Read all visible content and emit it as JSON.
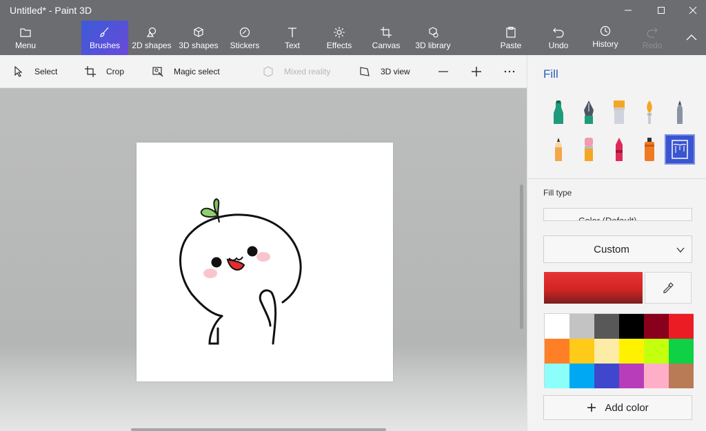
{
  "window": {
    "title": "Untitled* - Paint 3D"
  },
  "ribbon": {
    "items": [
      {
        "label": "Menu",
        "icon": "folder-icon"
      },
      {
        "label": "Brushes",
        "icon": "brush-icon",
        "active": true
      },
      {
        "label": "2D shapes",
        "icon": "2d-shapes-icon"
      },
      {
        "label": "3D shapes",
        "icon": "3d-cube-icon"
      },
      {
        "label": "Stickers",
        "icon": "sticker-icon"
      },
      {
        "label": "Text",
        "icon": "text-icon"
      },
      {
        "label": "Effects",
        "icon": "effects-sun-icon"
      },
      {
        "label": "Canvas",
        "icon": "canvas-crop-icon"
      },
      {
        "label": "3D library",
        "icon": "3d-library-icon"
      },
      {
        "label": "Paste",
        "icon": "paste-icon"
      },
      {
        "label": "Undo",
        "icon": "undo-icon"
      },
      {
        "label": "History",
        "icon": "history-icon"
      },
      {
        "label": "Redo",
        "icon": "redo-icon",
        "disabled": true
      }
    ]
  },
  "subtoolbar": {
    "select": "Select",
    "crop": "Crop",
    "magic_select": "Magic select",
    "mixed_reality": "Mixed reality",
    "view_3d": "3D view"
  },
  "panel": {
    "title": "Fill",
    "fill_type_label": "Fill type",
    "fill_type_value": "Color (Default)",
    "dropdown_value": "Custom",
    "current_color": "#d92a2a",
    "add_color_label": "Add color",
    "palette": [
      "#ffffff",
      "#c3c3c3",
      "#585858",
      "#000000",
      "#88001b",
      "#ec1c24",
      "#ff7f27",
      "#ffca18",
      "#fdeca6",
      "#fff200",
      "#c4ff0e",
      "#0ed145",
      "#8cfffb",
      "#00a8f3",
      "#3f48cc",
      "#b83dba",
      "#ffaec8",
      "#b97a56"
    ]
  },
  "brushes": [
    "marker-icon",
    "calligraphy-pen-icon",
    "oil-brush-icon",
    "watercolor-icon",
    "pixel-pen-icon",
    "pencil-icon",
    "eraser-icon",
    "crayon-icon",
    "spray-can-icon",
    "fill-bucket-icon"
  ]
}
